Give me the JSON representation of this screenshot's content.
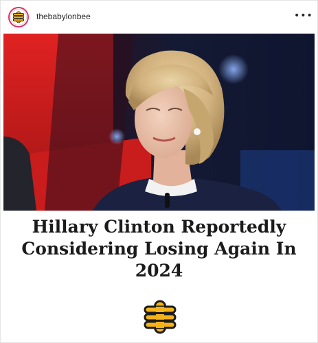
{
  "post": {
    "username": "thebabylonbee",
    "more_label": "•••",
    "headline": "Hillary Clinton Reportedly Considering Losing Again In 2024"
  },
  "colors": {
    "avatar_ring": "#e0306a",
    "bee_yellow": "#f4b31a",
    "bee_black": "#1b1b1b",
    "stage_red": "#c41a1a",
    "stage_blue": "#1d2a5c",
    "jacket_navy": "#1b2140"
  },
  "icons": {
    "avatar": "bee-logo-icon",
    "more": "more-options-icon",
    "footer_logo": "bee-logo-icon"
  }
}
